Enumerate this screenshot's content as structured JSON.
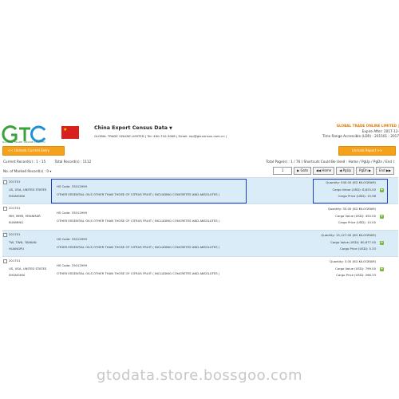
{
  "header": {
    "logo_text": "GTC",
    "logo_sub": "GLOBAL TRADE ONLINE LIMITED",
    "title": "China Export Census Data",
    "title_caret": "▼",
    "company_line": "GLOBAL TRADE ONLINE LIMITED | Tel: 400-710-3008 | Email: vip@gtccensus.com.cn |",
    "right_company": "GLOBAL TRADE ONLINE LIMITED |",
    "expire": "Expire After: 2017-12-",
    "time_range": "Time Range Accessible (LDR) : 201501 - 2017"
  },
  "toolbar": {
    "left_button": "<< Unmark Current Entry",
    "right_button": "Unmark Report >>"
  },
  "records": {
    "current": "Current Record(s) : 1 - 15",
    "total": "Total Record(s) : 1112",
    "marked_label": "No. of Marked Record(s) :",
    "marked_value": "0",
    "pages": "Total Page(s) : 1 / 76   ( Shortcuts Could Be Used : Home / PgUp / PgDn / End )"
  },
  "nav": {
    "page_value": "1",
    "goto": "▶ Goto",
    "home": "◀◀ Home",
    "pgup": "◀ PgUp",
    "pgdn": "PgDn ▶",
    "end": "End ▶▶"
  },
  "rows": [
    {
      "date": "201701",
      "port_line1": "US, USA, UNITED STATES",
      "port_line2": "SHANGHAI",
      "hs": "HS Code: 33012999",
      "desc": "OTHER ESSENTIAL OILS OTHER THAN THOSE OF CITRUS FRUIT ( INCLUDING CONCRETES AND ABSOLUTES )",
      "quantity": "Quantity: 540.00 (KG KILOGRAM)",
      "value": "Cargo Value (USD): 8,625.00",
      "price": "Cargo Price (USD): 15.98"
    },
    {
      "date": "201701",
      "port_line1": "MM, MMR, MYANMAR",
      "port_line2": "KUNMING",
      "hs": "HS Code: 33012999",
      "desc": "OTHER ESSENTIAL OILS OTHER THAN THOSE OF CITRUS FRUIT ( INCLUDING CONCRETES AND ABSOLUTES )",
      "quantity": "Quantity: 35.00 (KG KILOGRAM)",
      "value": "Cargo Value (USD): 450.00",
      "price": "Cargo Price (USD): 10.00"
    },
    {
      "date": "201701",
      "port_line1": "TW, TWN, TAIWAN",
      "port_line2": "HUANGPU",
      "hs": "HS Code: 33012999",
      "desc": "OTHER ESSENTIAL OILS OTHER THAN THOSE OF CITRUS FRUIT ( INCLUDING CONCRETES AND ABSOLUTES )",
      "quantity": "Quantity: 15,127.00 (KG KILOGRAM)",
      "value": "Cargo Value (USD): 80,677.00",
      "price": "Cargo Price (USD): 5.33"
    },
    {
      "date": "201701",
      "port_line1": "US, USA, UNITED STATES",
      "port_line2": "SHANGHAI",
      "hs": "HS Code: 33012999",
      "desc": "OTHER ESSENTIAL OILS OTHER THAN THOSE OF CITRUS FRUIT ( INCLUDING CONCRETES AND ABSOLUTES )",
      "quantity": "Quantity: 3.00 (KG KILOGRAM)",
      "value": "Cargo Value (USD): 799.00",
      "price": "Cargo Price (USD): 266.33"
    }
  ],
  "watermark": "gtodata.store.bossgoo.com"
}
